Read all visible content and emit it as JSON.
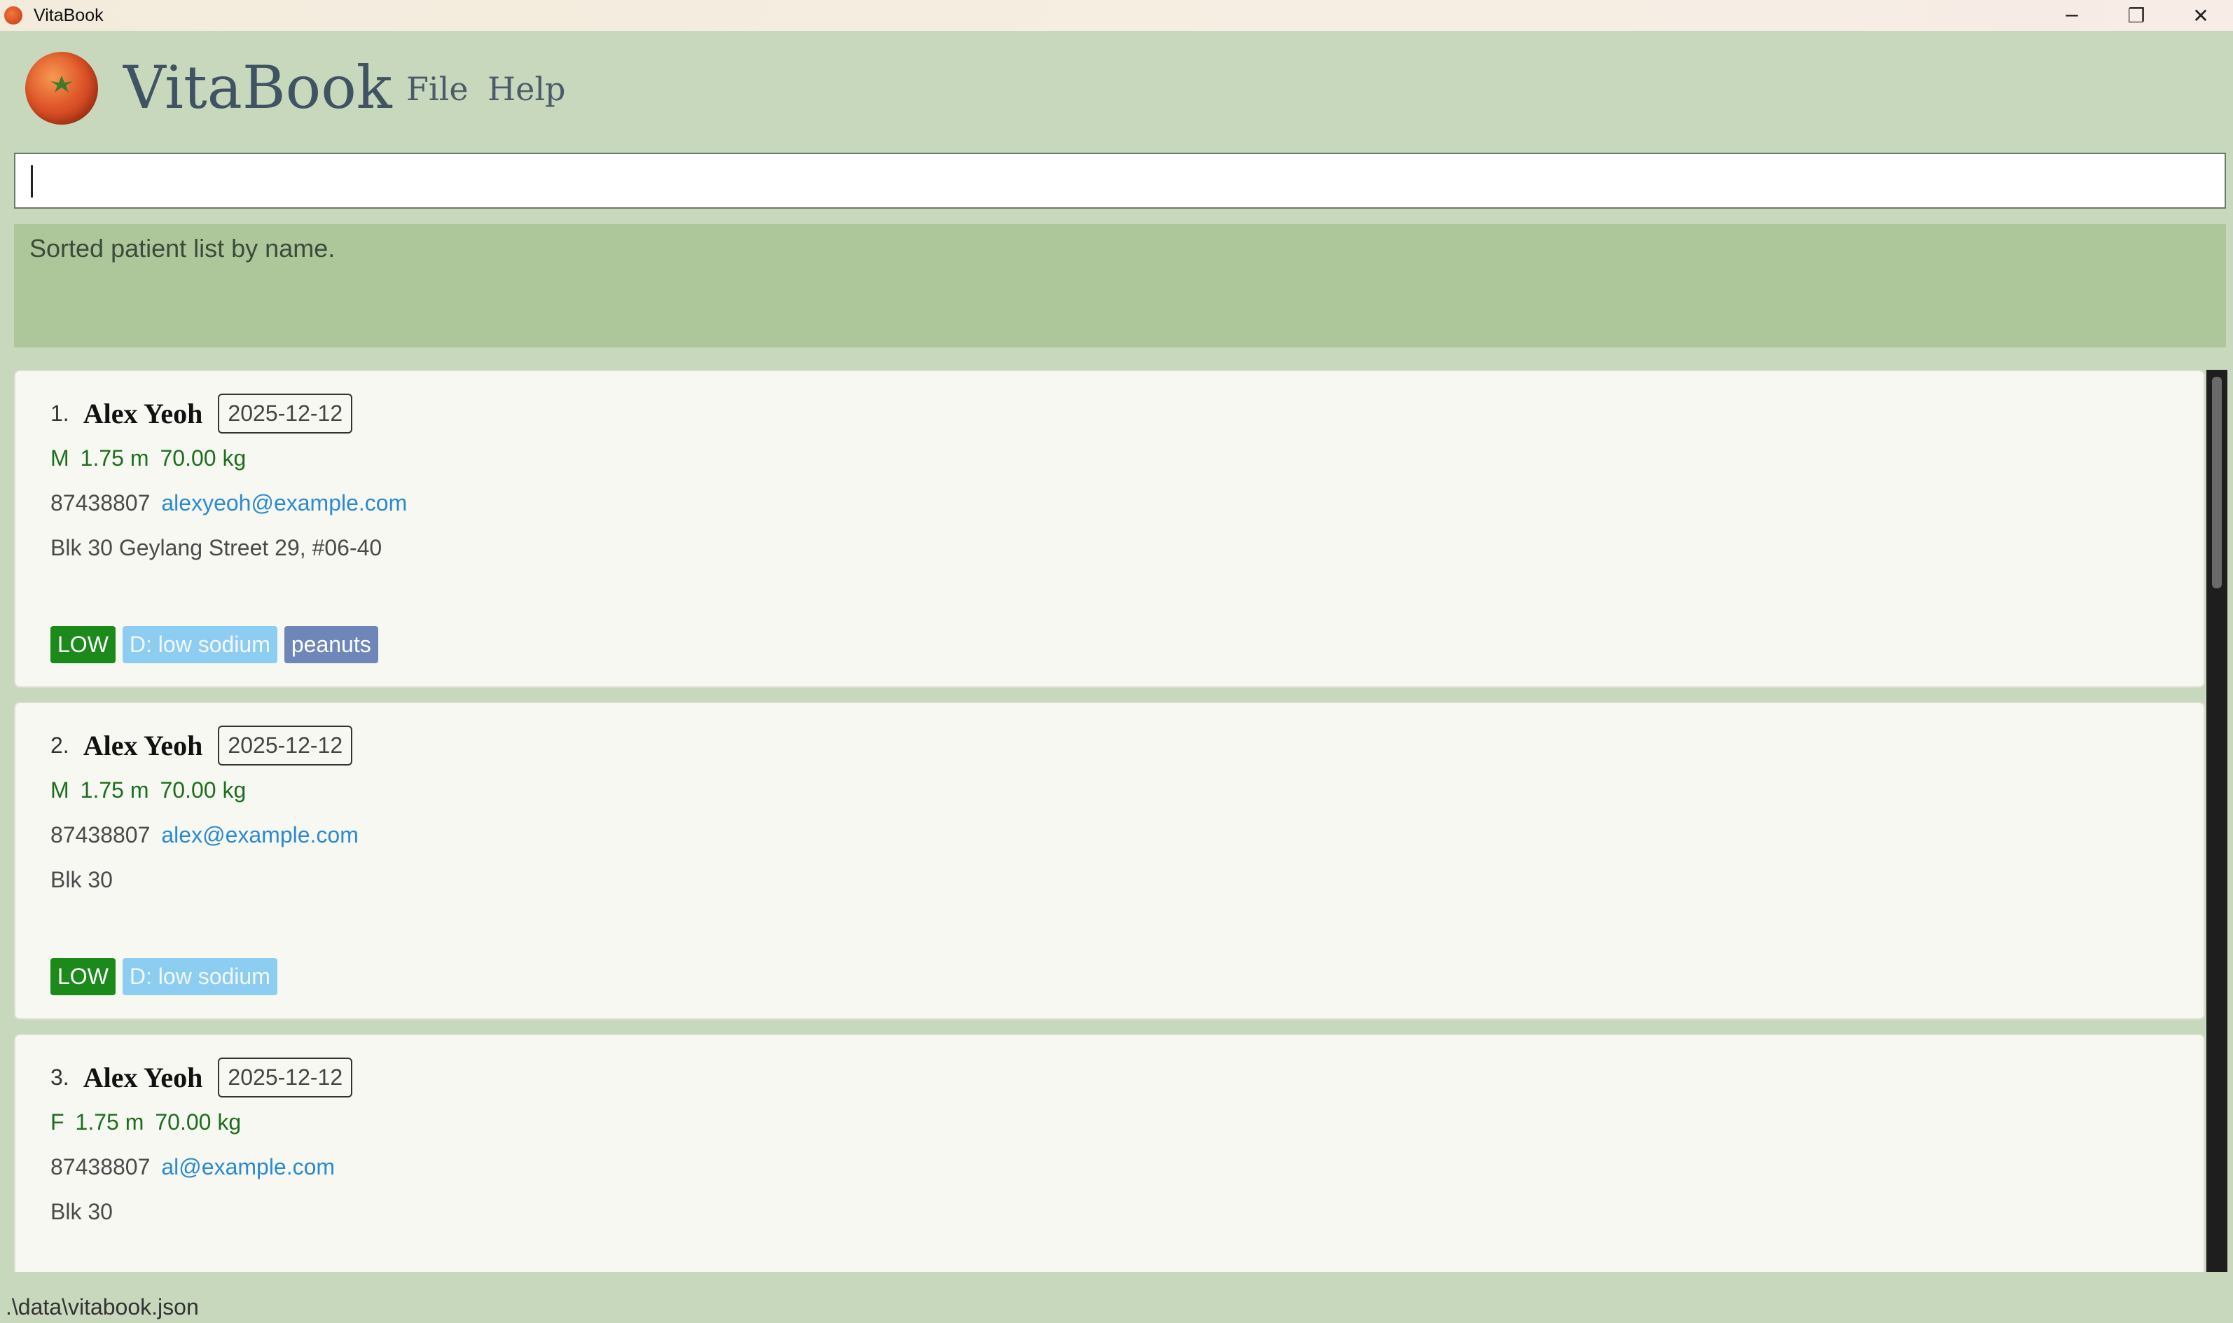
{
  "window": {
    "title": "VitaBook",
    "controls": {
      "minimize": "─",
      "restore": "❐",
      "close": "✕"
    }
  },
  "header": {
    "app_name": "VitaBook",
    "menu": {
      "file": "File",
      "help": "Help"
    }
  },
  "command_box": {
    "value": ""
  },
  "result_display": {
    "text": "Sorted patient list by name."
  },
  "patients": [
    {
      "index": "1.",
      "name": "Alex Yeoh",
      "date": "2025-12-12",
      "gender": "M",
      "height": "1.75 m",
      "weight": "70.00 kg",
      "phone": "87438807",
      "email": "alexyeoh@example.com",
      "address": "Blk 30 Geylang Street 29, #06-40",
      "tags": {
        "priority": "LOW",
        "diet": "D: low sodium",
        "allergy": "peanuts"
      }
    },
    {
      "index": "2.",
      "name": "Alex Yeoh",
      "date": "2025-12-12",
      "gender": "M",
      "height": "1.75 m",
      "weight": "70.00 kg",
      "phone": "87438807",
      "email": "alex@example.com",
      "address": "Blk 30",
      "tags": {
        "priority": "LOW",
        "diet": "D: low sodium"
      }
    },
    {
      "index": "3.",
      "name": "Alex Yeoh",
      "date": "2025-12-12",
      "gender": "F",
      "height": "1.75 m",
      "weight": "70.00 kg",
      "phone": "87438807",
      "email": "al@example.com",
      "address": "Blk 30"
    }
  ],
  "status_bar": {
    "path": ".\\data\\vitabook.json"
  },
  "colors": {
    "background": "#c8d8bc",
    "result_bg": "#adc69a",
    "tag_low": "#1b8a1b",
    "tag_diet": "#8dcdf2",
    "tag_allergy": "#6f86b8",
    "email": "#2b8ad0",
    "vitals": "#1e6e1e"
  }
}
